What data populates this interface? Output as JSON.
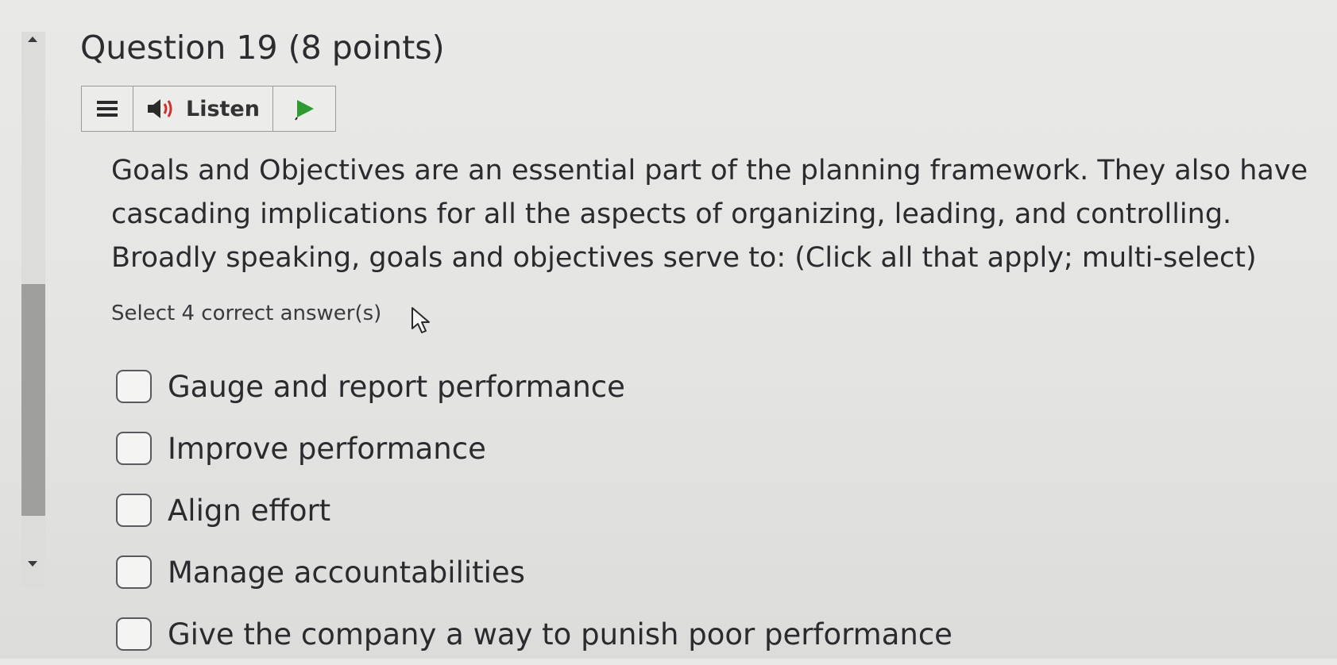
{
  "question": {
    "title": "Question 19 (8 points)",
    "text_lines": [
      "Goals and Objectives are an essential part of the planning framework. They also have",
      "cascading implications for all the aspects of organizing, leading, and controlling.",
      "Broadly speaking, goals and objectives serve to: (Click all that apply; multi-select)"
    ],
    "instruction": "Select 4 correct answer(s)"
  },
  "toolbar": {
    "listen_label": "Listen",
    "icons": {
      "menu": "hamburger-menu-icon",
      "audio": "speaker-icon",
      "play": "play-icon"
    },
    "play_color": "#2f9a2f"
  },
  "options": [
    {
      "label": "Gauge and report performance",
      "checked": false
    },
    {
      "label": "Improve performance",
      "checked": false
    },
    {
      "label": "Align effort",
      "checked": false
    },
    {
      "label": "Manage accountabilities",
      "checked": false
    },
    {
      "label": "Give the company a way to punish poor performance",
      "checked": false
    }
  ]
}
